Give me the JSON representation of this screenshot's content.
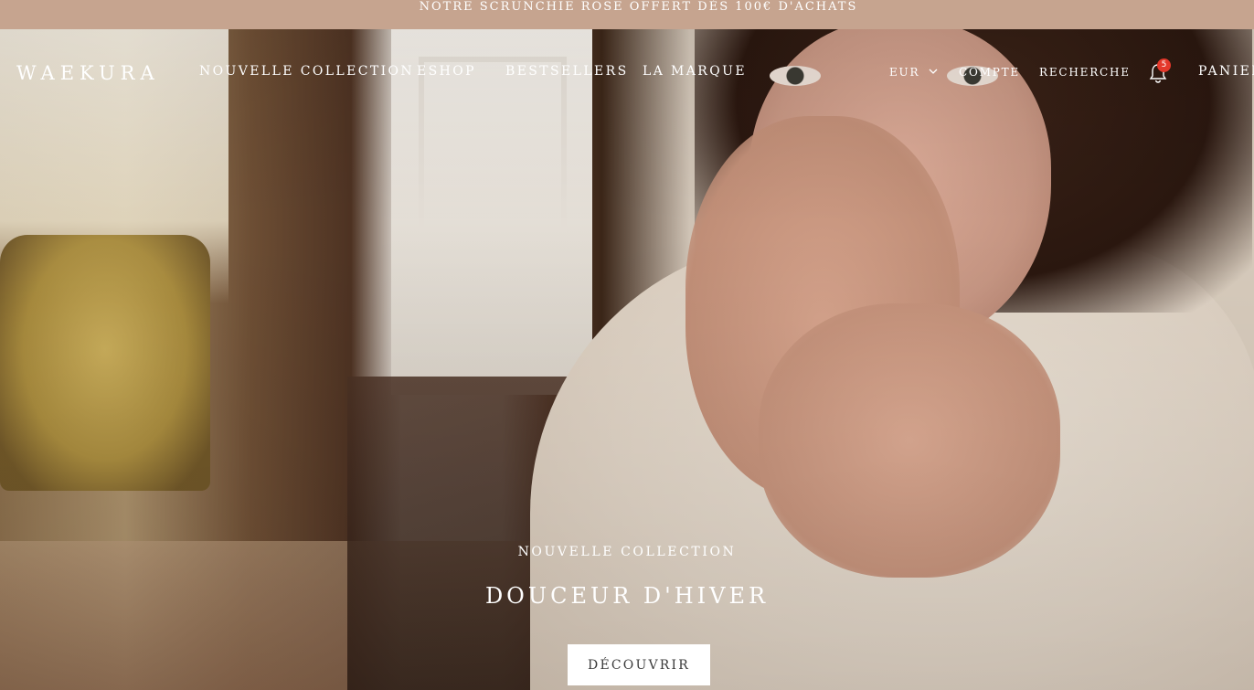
{
  "announcement": {
    "text": "NOTRE SCRUNCHIE ROSE OFFERT DÈS 100€ D'ACHATS"
  },
  "header": {
    "logo": "WAEKURA",
    "nav": [
      "NOUVELLE COLLECTION",
      "ESHOP",
      "BESTSELLERS",
      "LA MARQUE"
    ],
    "currency": "EUR",
    "account": "COMPTE",
    "search": "RECHERCHE",
    "notifications_count": "5",
    "cart": "PANIER"
  },
  "hero": {
    "eyebrow": "NOUVELLE COLLECTION",
    "headline": "DOUCEUR D'HIVER",
    "cta": "DÉCOUVRIR"
  },
  "colors": {
    "announcement_bg": "#c6a48f",
    "badge": "#e4382b"
  },
  "icons": {
    "currency_dropdown": "chevron-down-icon",
    "notifications": "bell-icon"
  }
}
